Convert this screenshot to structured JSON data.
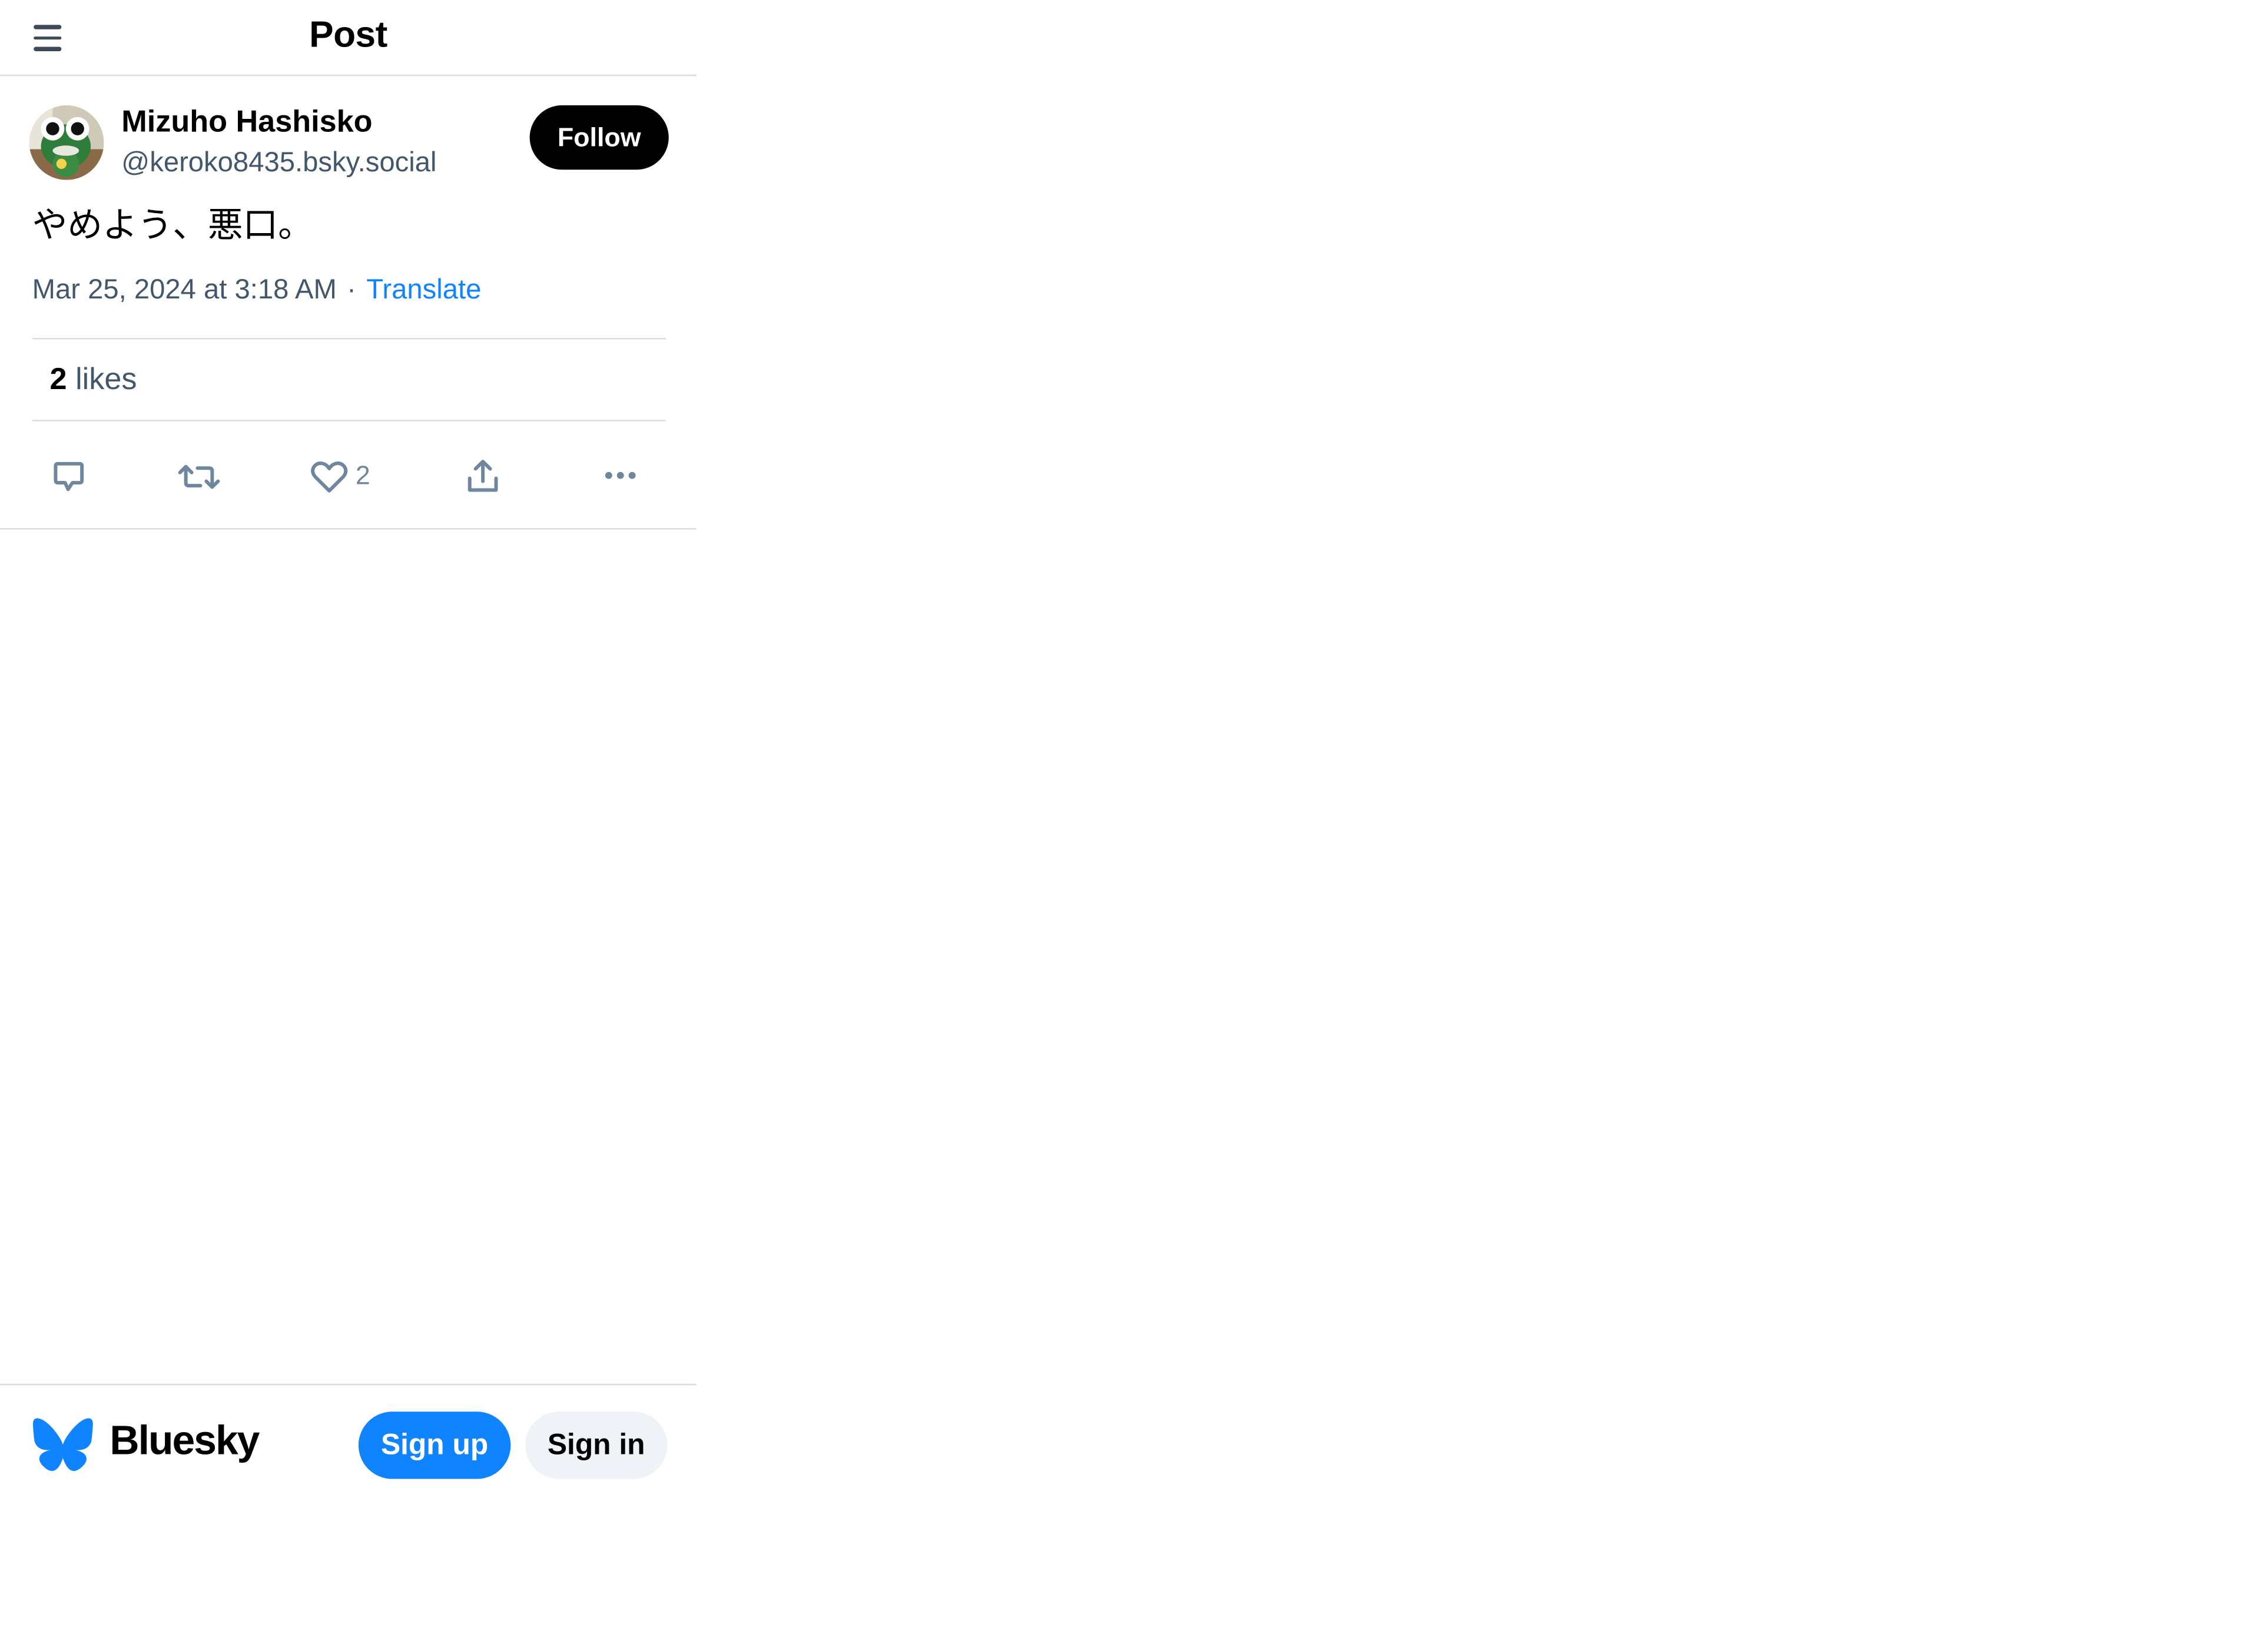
{
  "header": {
    "title": "Post",
    "menu_icon": "hamburger-menu-icon"
  },
  "post": {
    "author": {
      "display_name": "Mizuho Hashisko",
      "handle": "@keroko8435.bsky.social",
      "avatar_icon": "frog-avatar"
    },
    "follow_label": "Follow",
    "text": "やめよう、悪口。",
    "timestamp": "Mar 25, 2024 at 3:18 AM",
    "separator": "·",
    "translate_label": "Translate",
    "likes": {
      "count": "2",
      "label": "likes"
    },
    "actions": [
      {
        "name": "reply",
        "icon": "reply-icon"
      },
      {
        "name": "repost",
        "icon": "repost-icon"
      },
      {
        "name": "like",
        "icon": "heart-icon",
        "count": "2"
      },
      {
        "name": "share",
        "icon": "share-icon"
      },
      {
        "name": "more",
        "icon": "more-options-icon"
      }
    ]
  },
  "bottom_bar": {
    "brand": "Bluesky",
    "logo_icon": "butterfly-icon",
    "signup_label": "Sign up",
    "signin_label": "Sign in"
  },
  "colors": {
    "accent": "#1083fe",
    "text_muted": "#42576c",
    "icon_gray": "#6f869f",
    "border": "#d8dde3",
    "follow_bg": "#000000",
    "signin_bg": "#eff2f6"
  }
}
